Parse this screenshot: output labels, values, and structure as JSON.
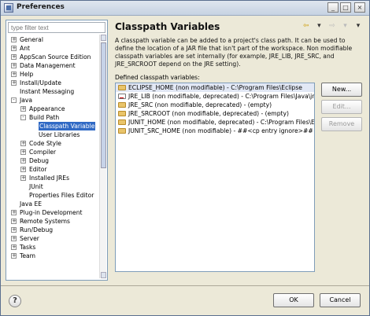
{
  "window": {
    "title": "Preferences"
  },
  "filter": {
    "placeholder": "type filter text"
  },
  "tree": [
    {
      "label": "General",
      "level": 0,
      "expander": "+"
    },
    {
      "label": "Ant",
      "level": 0,
      "expander": "+"
    },
    {
      "label": "AppScan Source Edition",
      "level": 0,
      "expander": "+"
    },
    {
      "label": "Data Management",
      "level": 0,
      "expander": "+"
    },
    {
      "label": "Help",
      "level": 0,
      "expander": "+"
    },
    {
      "label": "Install/Update",
      "level": 0,
      "expander": "+"
    },
    {
      "label": "Instant Messaging",
      "level": 0,
      "expander": ""
    },
    {
      "label": "Java",
      "level": 0,
      "expander": "-"
    },
    {
      "label": "Appearance",
      "level": 1,
      "expander": "+"
    },
    {
      "label": "Build Path",
      "level": 1,
      "expander": "-"
    },
    {
      "label": "Classpath Variable",
      "level": 2,
      "expander": "",
      "selected": true
    },
    {
      "label": "User Libraries",
      "level": 2,
      "expander": ""
    },
    {
      "label": "Code Style",
      "level": 1,
      "expander": "+"
    },
    {
      "label": "Compiler",
      "level": 1,
      "expander": "+"
    },
    {
      "label": "Debug",
      "level": 1,
      "expander": "+"
    },
    {
      "label": "Editor",
      "level": 1,
      "expander": "+"
    },
    {
      "label": "Installed JREs",
      "level": 1,
      "expander": "+"
    },
    {
      "label": "JUnit",
      "level": 1,
      "expander": ""
    },
    {
      "label": "Properties Files Editor",
      "level": 1,
      "expander": ""
    },
    {
      "label": "Java EE",
      "level": 0,
      "expander": ""
    },
    {
      "label": "Plug-in Development",
      "level": 0,
      "expander": "+"
    },
    {
      "label": "Remote Systems",
      "level": 0,
      "expander": "+"
    },
    {
      "label": "Run/Debug",
      "level": 0,
      "expander": "+"
    },
    {
      "label": "Server",
      "level": 0,
      "expander": "+"
    },
    {
      "label": "Tasks",
      "level": 0,
      "expander": "+"
    },
    {
      "label": "Team",
      "level": 0,
      "expander": "+"
    }
  ],
  "page": {
    "heading": "Classpath Variables",
    "description": "A classpath variable can be added to a project's class path. It can be used to define the location of a JAR file that isn't part of the workspace. Non modifiable classpath variables are set internally (for example, JRE_LIB, JRE_SRC, and JRE_SRCROOT depend on the JRE setting).",
    "defined_label": "Defined classpath variables:",
    "variables": [
      {
        "text": "ECLIPSE_HOME (non modifiable) - C:\\Program Files\\Eclipse",
        "icon": "folder-icon"
      },
      {
        "text": "JRE_LIB (non modifiable, deprecated) - C:\\Program Files\\Java\\jre",
        "icon": "jar-icon"
      },
      {
        "text": "JRE_SRC (non modifiable, deprecated) - (empty)",
        "icon": "folder-icon"
      },
      {
        "text": "JRE_SRCROOT (non modifiable, deprecated) - (empty)",
        "icon": "folder-icon"
      },
      {
        "text": "JUNIT_HOME (non modifiable, deprecated) - C:\\Program Files\\Ec",
        "icon": "folder-icon"
      },
      {
        "text": "JUNIT_SRC_HOME (non modifiable) - ##<cp entry ignore>##",
        "icon": "folder-icon"
      }
    ],
    "buttons": {
      "new": "New...",
      "edit": "Edit...",
      "remove": "Remove"
    }
  },
  "footer": {
    "help": "?",
    "ok": "OK",
    "cancel": "Cancel"
  },
  "colors": {
    "selection": "#316ac5",
    "titlebar": "#c6d2e2"
  }
}
